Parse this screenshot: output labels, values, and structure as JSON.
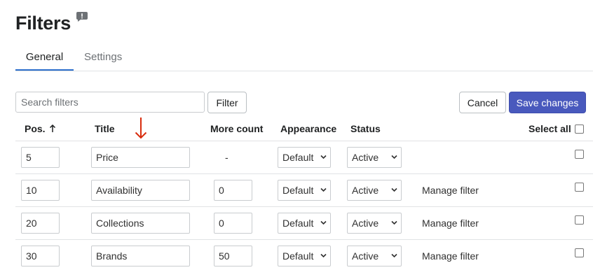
{
  "page": {
    "title": "Filters",
    "help_icon": "feedback-icon"
  },
  "tabs": [
    {
      "label": "General",
      "active": true
    },
    {
      "label": "Settings",
      "active": false
    }
  ],
  "toolbar": {
    "search_placeholder": "Search filters",
    "search_value": "",
    "filter_label": "Filter",
    "cancel_label": "Cancel",
    "save_label": "Save changes"
  },
  "table": {
    "headers": {
      "pos": "Pos.",
      "pos_sort_icon": "arrow-up-icon",
      "title": "Title",
      "more_count": "More count",
      "appearance": "Appearance",
      "status": "Status",
      "select_all": "Select all"
    },
    "annotation_icon": "red-arrow-down-icon",
    "rows": [
      {
        "pos": "5",
        "title": "Price",
        "more_count": "-",
        "appearance": "Default",
        "status": "Active",
        "manage": "",
        "selected": false
      },
      {
        "pos": "10",
        "title": "Availability",
        "more_count": "0",
        "appearance": "Default",
        "status": "Active",
        "manage": "Manage filter",
        "selected": false
      },
      {
        "pos": "20",
        "title": "Collections",
        "more_count": "0",
        "appearance": "Default",
        "status": "Active",
        "manage": "Manage filter",
        "selected": false
      },
      {
        "pos": "30",
        "title": "Brands",
        "more_count": "50",
        "appearance": "Default",
        "status": "Active",
        "manage": "Manage filter",
        "selected": false
      }
    ]
  },
  "colors": {
    "primary_button": "#4959bd",
    "tab_active_underline": "#2c6ecb",
    "annotation_arrow": "#d82c0d"
  }
}
